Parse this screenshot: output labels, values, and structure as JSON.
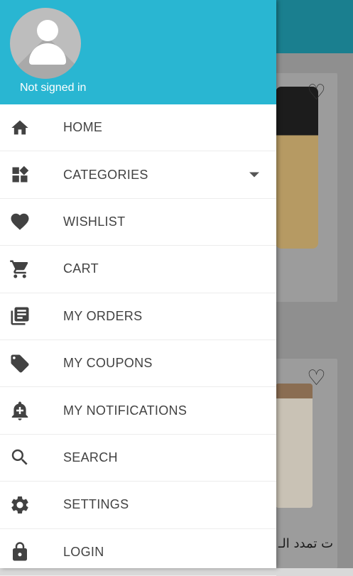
{
  "header": {
    "status_text": "Not signed in"
  },
  "menu": {
    "items": [
      {
        "label": "HOME",
        "icon": "home-icon"
      },
      {
        "label": "CATEGORIES",
        "icon": "categories-icon",
        "has_dropdown": true
      },
      {
        "label": "WISHLIST",
        "icon": "heart-icon"
      },
      {
        "label": "CART",
        "icon": "cart-icon"
      },
      {
        "label": "MY ORDERS",
        "icon": "orders-icon"
      },
      {
        "label": "MY COUPONS",
        "icon": "tag-icon"
      },
      {
        "label": "MY NOTIFICATIONS",
        "icon": "bell-plus-icon"
      },
      {
        "label": "SEARCH",
        "icon": "search-icon"
      },
      {
        "label": "SETTINGS",
        "icon": "gear-icon"
      },
      {
        "label": "LOGIN",
        "icon": "lock-icon"
      }
    ]
  },
  "background": {
    "product_title_partial": "ت تمدد الـ"
  },
  "colors": {
    "header": "#29b6d2",
    "toolbar": "#1a7f8f",
    "icon": "#424242",
    "label": "#424242"
  }
}
